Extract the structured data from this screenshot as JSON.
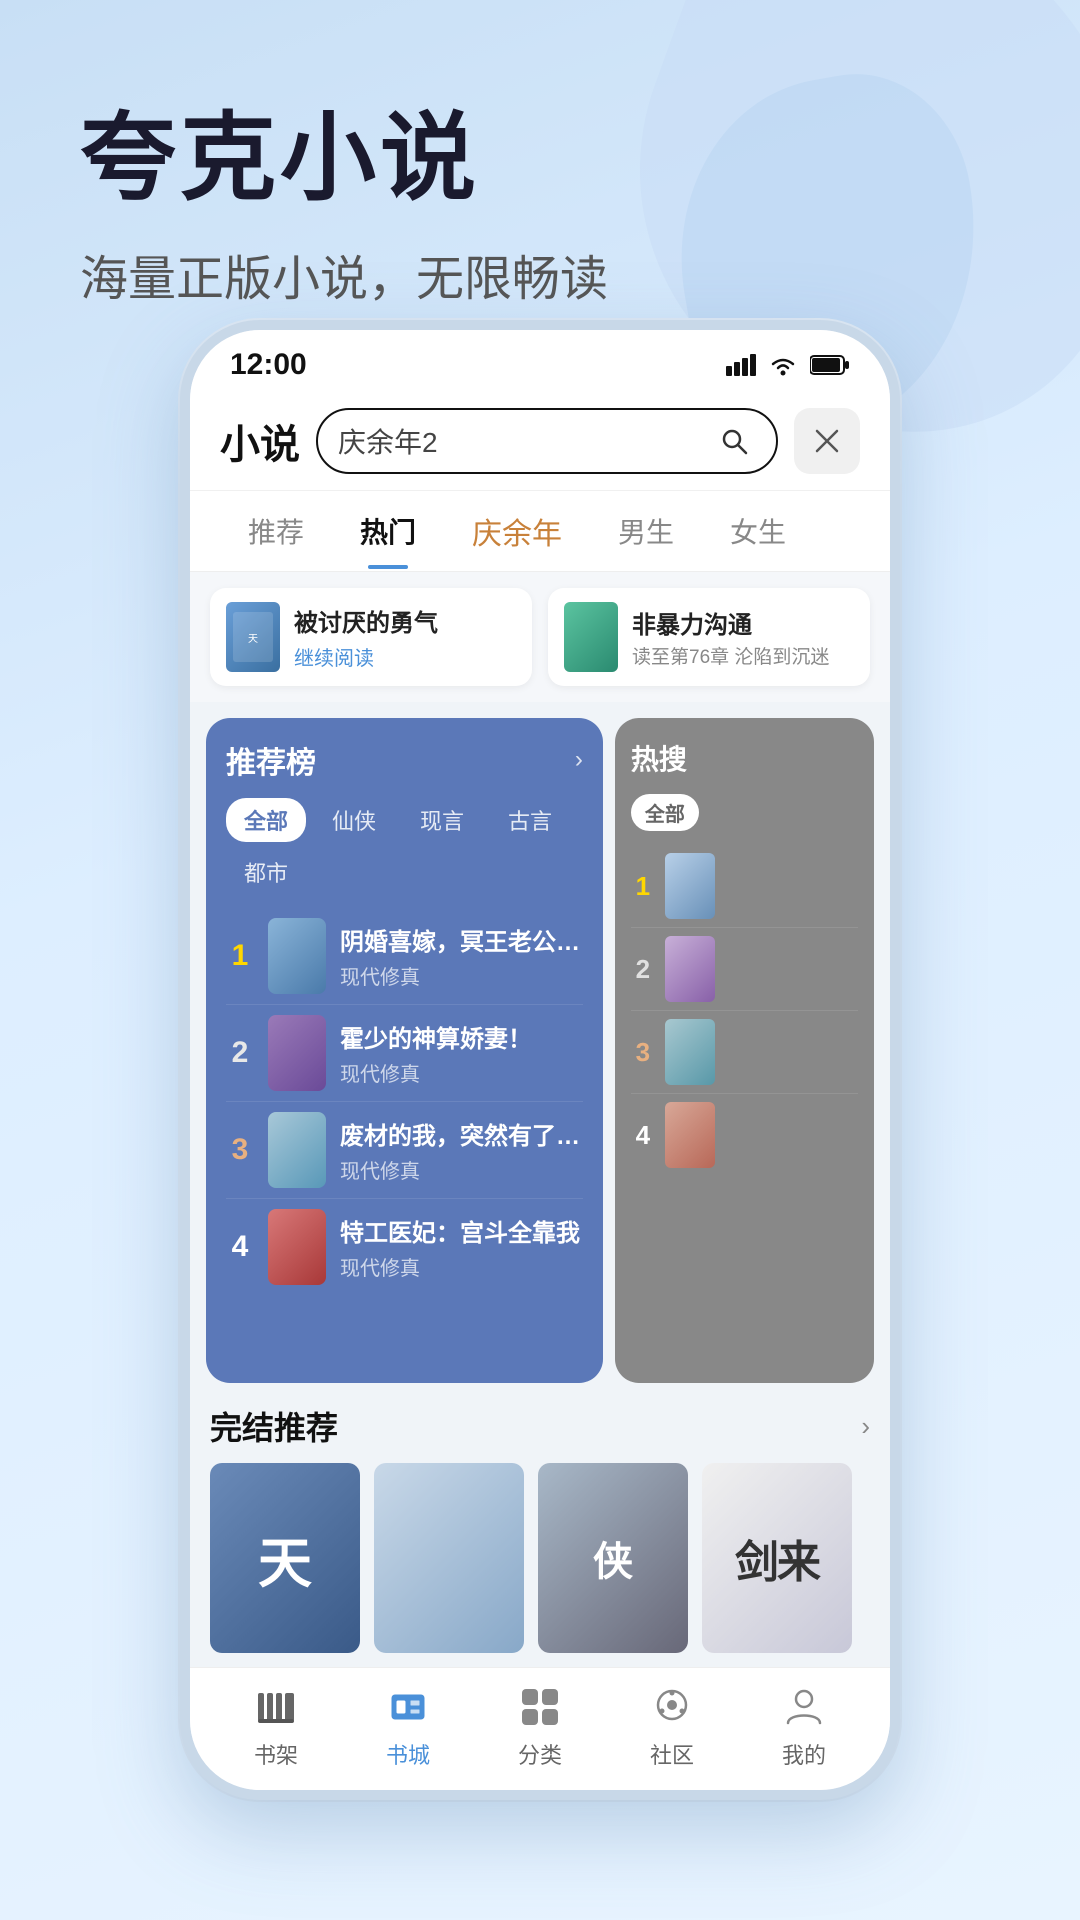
{
  "promo": {
    "title": "夸克小说",
    "subtitle": "海量正版小说，无限畅读"
  },
  "statusBar": {
    "time": "12:00"
  },
  "header": {
    "title": "小说",
    "searchPlaceholder": "庆余年2",
    "closeLabel": "×"
  },
  "navTabs": [
    {
      "label": "推荐",
      "active": false
    },
    {
      "label": "热门",
      "active": true
    },
    {
      "label": "庆余年",
      "active": false,
      "special": true
    },
    {
      "label": "男生",
      "active": false
    },
    {
      "label": "女生",
      "active": false
    }
  ],
  "recentReads": [
    {
      "title": "被讨厌的勇气",
      "action": "继续阅读",
      "progress": ""
    },
    {
      "title": "非暴力沟通",
      "action": "",
      "progress": "读至第76章 沦陷到沉迷"
    }
  ],
  "recList": {
    "title": "推荐榜",
    "more": "›",
    "filters": [
      "全部",
      "仙侠",
      "现言",
      "古言",
      "都市"
    ],
    "activeFilter": "全部",
    "books": [
      {
        "rank": "1",
        "title": "阴婚喜嫁，冥王老公沦陷了",
        "genre": "现代修真"
      },
      {
        "rank": "2",
        "title": "霍少的神算娇妻！",
        "genre": "现代修真"
      },
      {
        "rank": "3",
        "title": "废材的我，突然有了亿万年",
        "genre": "现代修真"
      },
      {
        "rank": "4",
        "title": "特工医妃：宫斗全靠我",
        "genre": "现代修真"
      }
    ]
  },
  "hotList": {
    "title": "热搜",
    "filters": [
      "全部"
    ],
    "activeFilter": "全部",
    "books": [
      {
        "rank": "1"
      },
      {
        "rank": "2"
      },
      {
        "rank": "3"
      },
      {
        "rank": "4"
      }
    ]
  },
  "completedSection": {
    "title": "完结推荐",
    "more": "›",
    "books": [
      {
        "id": 1,
        "text": "天"
      },
      {
        "id": 2
      },
      {
        "id": 3
      },
      {
        "id": 4,
        "text": "剑来"
      }
    ]
  },
  "bottomNav": [
    {
      "id": "bookshelf",
      "label": "书架",
      "active": false
    },
    {
      "id": "bookstore",
      "label": "书城",
      "active": true
    },
    {
      "id": "category",
      "label": "分类",
      "active": false
    },
    {
      "id": "community",
      "label": "社区",
      "active": false
    },
    {
      "id": "profile",
      "label": "我的",
      "active": false
    }
  ]
}
